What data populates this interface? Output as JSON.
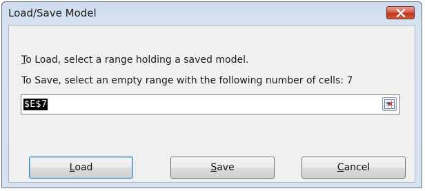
{
  "window": {
    "title": "Load/Save Model"
  },
  "icons": {
    "close": "close-icon",
    "range_collapse": "range-collapse-icon"
  },
  "colors": {
    "close_button": "#c1341f",
    "default_button_border": "#3c7fb1",
    "selection_bg": "#000000"
  },
  "instructions": {
    "load_hotkey": "T",
    "load_rest": "o Load, select a range holding a saved model.",
    "save_text": "To Save, select an empty range with the following number of cells: 7"
  },
  "range_input": {
    "value": "$E$7"
  },
  "buttons": {
    "load_hotkey": "L",
    "load_rest": "oad",
    "save_hotkey": "S",
    "save_rest": "ave",
    "cancel_hotkey": "C",
    "cancel_rest": "ancel"
  }
}
